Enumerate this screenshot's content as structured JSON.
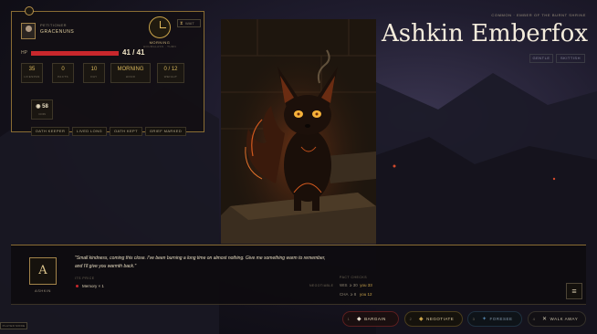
{
  "player": {
    "title": "PETITIONER",
    "name": "GRACENUNS",
    "hp_label": "HP",
    "hp_current": 41,
    "hp_max": 41,
    "hp_text": "41 / 41",
    "hp_fraction": 1.0,
    "stats": [
      {
        "value": "35",
        "label": "LIFESPAN"
      },
      {
        "value": "0",
        "label": "PACTS"
      },
      {
        "value": "10",
        "label": "DAY"
      },
      {
        "value": "MORNING",
        "label": "HOUR"
      },
      {
        "value": "0 / 12",
        "label": "WEIGHT"
      }
    ],
    "coin": {
      "value": "58",
      "label": "COIN"
    },
    "tags": [
      "OATH KEEPER",
      "LIVED LONG",
      "OATH KEPT",
      "GRIEF MARKED"
    ]
  },
  "clock": {
    "time": "MORNING",
    "sub": "HOURGLASS · TURN",
    "wait_label": "WAIT"
  },
  "npc": {
    "subtitle": "COMMON · EMBER OF THE BURNT SHRINE",
    "name": "Ashkin Emberfox",
    "traits": [
      "GENTLE",
      "SKITTISH"
    ]
  },
  "dialog": {
    "speaker_initial": "A",
    "speaker_name": "ASHKIN",
    "quote": "\"Small kindness, coming this close. I've been burning a long time on almost nothing. Give me something warm to remember, and I'll give you warmth back.\"",
    "price_label": "ITS PRICE",
    "price_item": "Memory × 1",
    "pact_label": "PACT CHECKS",
    "pact_negotiable": "NEGOTIABLE",
    "checks": [
      {
        "stat": "WIS",
        "req": "≥ 30",
        "you": "you 33"
      },
      {
        "stat": "CHA",
        "req": "≥ 8",
        "you": "you 12"
      }
    ],
    "menu_icon": "≡"
  },
  "actions": [
    {
      "key": "1",
      "label": "BARGAIN",
      "glyph": "◆",
      "color": "#c8272c"
    },
    {
      "key": "2",
      "label": "NEGOTIATE",
      "glyph": "◆",
      "color": "#c9a34a"
    },
    {
      "key": "3",
      "label": "FORESEE",
      "glyph": "✦",
      "color": "#4f7fa6"
    },
    {
      "key": "4",
      "label": "WALK AWAY",
      "glyph": "✕",
      "color": "#8d8471"
    }
  ],
  "player_mode_label": "PLAYER MODE"
}
